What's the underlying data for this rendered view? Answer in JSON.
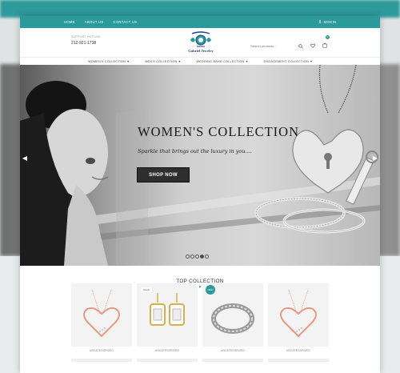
{
  "topbar": {
    "nav": [
      "HOME",
      "ABOUT US",
      "CONTACT US"
    ],
    "signin": "SIGN IN"
  },
  "header": {
    "support_label": "SUPPORT HOTLINE",
    "phone": "212-921-1738",
    "logo_text": "Gabriel Jewelry",
    "search_placeholder": "Search products...",
    "cart_count": "0"
  },
  "categories": [
    "WOMEN'S COLLECTION",
    "MEN'S COLLECTION",
    "WEDDING BAND COLLECTION",
    "ENGAGEMENT COLLECTION"
  ],
  "hero": {
    "title": "WOMEN'S COLLECTION",
    "tagline": "Sparkle that brings out the luxury in you....",
    "button": "SHOP NOW",
    "slides": 5,
    "active_slide": 4
  },
  "top_collection": {
    "title": "TOP COLLECTION",
    "products": [
      {
        "tag": "",
        "category": "UNCATEGORIZED"
      },
      {
        "tag": "SALE",
        "category": "UNCATEGORIZED"
      },
      {
        "tag": "NEW",
        "category": "UNCATEGORIZED"
      },
      {
        "tag": "",
        "category": "UNCATEGORIZED"
      }
    ]
  },
  "colors": {
    "accent": "#2a9a9b",
    "button_dark": "#2e2e2e",
    "logo_blue": "#1f3e8c"
  }
}
